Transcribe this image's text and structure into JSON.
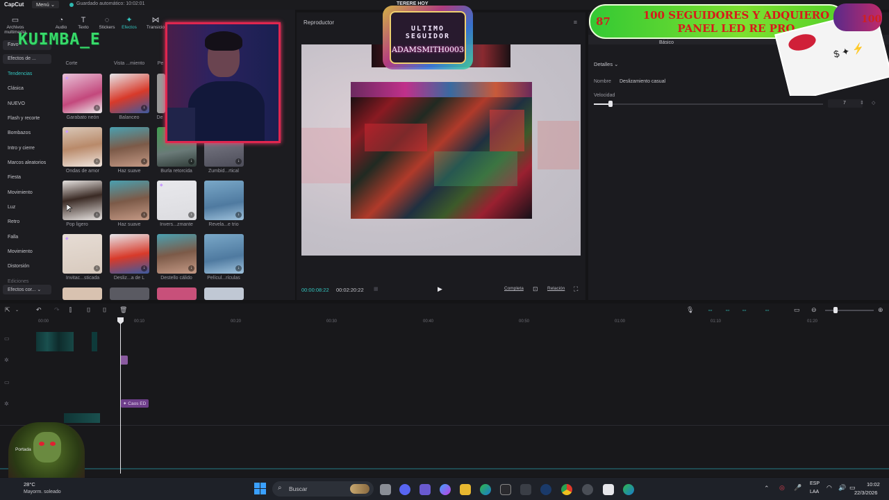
{
  "titlebar": {
    "app": "CapCut",
    "menu": "Menú ⌄",
    "saved": "Guardado automático: 10:02:01"
  },
  "tools": [
    {
      "label": "Archivos multimedia",
      "icon": "▭"
    },
    {
      "label": "Audio",
      "icon": "◔"
    },
    {
      "label": "Texto",
      "icon": "T"
    },
    {
      "label": "Stickers",
      "icon": "◌"
    },
    {
      "label": "Efectos",
      "icon": "✦"
    },
    {
      "label": "Transicio",
      "icon": "⋈"
    }
  ],
  "sidebar": {
    "top_items": [
      "Favo",
      "Efectos de ..."
    ],
    "items": [
      "Tendencias",
      "Clásica",
      "NUEVO",
      "Flash y recorte",
      "Bombazos",
      "Intro y cierre",
      "Marcos aleatorios",
      "Fiesta",
      "Movimiento",
      "Luz",
      "Retro",
      "Falla",
      "Movimiento",
      "Distorsión",
      "Ediciones"
    ],
    "bottom": "Efectos cor... ⌄"
  },
  "effects": {
    "row0": [
      "Corte",
      "Vista ...miento",
      "Pe"
    ],
    "row1": [
      "Garabato neón",
      "Balanceo",
      "De"
    ],
    "row2": [
      "Ondas de amor",
      "Haz suave",
      "Burla retorcida",
      "Zumbid...rtical"
    ],
    "row3": [
      "Pop ligero",
      "Haz suave",
      "Invers...zmante",
      "Revela...e trio"
    ],
    "row4": [
      "Invitac...sticada",
      "Desliz...a de L",
      "Destello cálido",
      "Películ...rículas"
    ]
  },
  "player": {
    "header": "Reproductor",
    "current_time": "00:00:08:22",
    "total_time": "00:02:20:22",
    "btn_complete": "Completa",
    "btn_ratio": "Relación"
  },
  "details": {
    "tab_basic": "Básico",
    "section": "Detalles ⌄",
    "name_label": "Nombre",
    "name_value": "Deslizamiento casual",
    "speed_label": "Velocidad",
    "speed_value": "7"
  },
  "timeline": {
    "ruler": [
      "00:00",
      "00:10",
      "00:20",
      "00:30",
      "00:40",
      "00:50",
      "01:00",
      "01:10",
      "01:20"
    ],
    "effect_clip": "Caos ED",
    "cover_label": "Portada"
  },
  "overlays": {
    "banner_left_num": "87",
    "banner_text": "100 SEGUIDORES Y ADQUIERO PANEL LED RE PRO",
    "banner_right_num": "100",
    "tereré": "TERERE HOY",
    "last_follower_title": "ULTIMO SEGUIDOR",
    "last_follower_name": "ADAMSMITH0003",
    "watermark": "KUIMBA_E"
  },
  "taskbar": {
    "search": "Buscar",
    "weather_temp": "28°C",
    "weather_desc": "Mayorm. soleado",
    "lang1": "ESP",
    "lang2": "LAA",
    "time": "10:02",
    "date": "22/3/2026"
  },
  "colors": {
    "accent": "#34c6c0",
    "webcam_border": "#e0264f",
    "banner_green": "#55d02a",
    "banner_text": "#d81a1a"
  }
}
